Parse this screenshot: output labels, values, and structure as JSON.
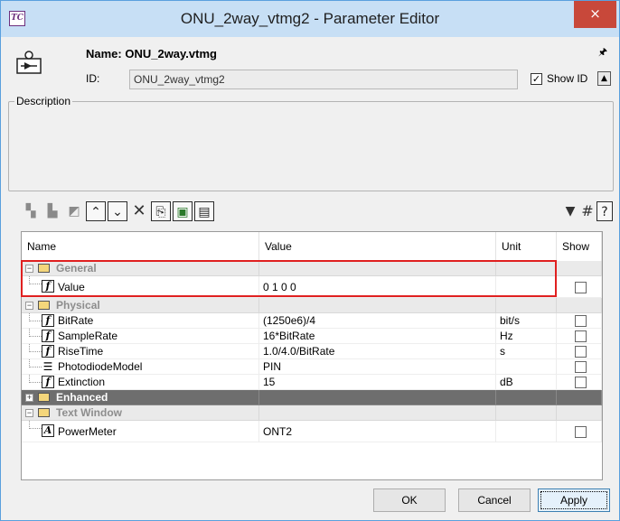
{
  "window": {
    "title": "ONU_2way_vtmg2 - Parameter Editor",
    "app_icon_text": "TC",
    "close_symbol": "×"
  },
  "header": {
    "name_label": "Name: ONU_2way.vtmg",
    "id_label": "ID:",
    "id_value": "ONU_2way_vtmg2",
    "show_id_label": "Show ID",
    "show_id_checked": true
  },
  "description": {
    "label": "Description",
    "text": ""
  },
  "table": {
    "columns": [
      "Name",
      "Value",
      "Unit",
      "Show"
    ],
    "groups": [
      {
        "label": "General",
        "expanded": true,
        "params": [
          {
            "type": "f",
            "name": "Value",
            "value": "0 1 0 0",
            "unit": "",
            "show": false
          }
        ]
      },
      {
        "label": "Physical",
        "expanded": true,
        "params": [
          {
            "type": "f",
            "name": "BitRate",
            "value": "(1250e6)/4",
            "unit": "bit/s",
            "show": false
          },
          {
            "type": "f",
            "name": "SampleRate",
            "value": "16*BitRate",
            "unit": "Hz",
            "show": false
          },
          {
            "type": "f",
            "name": "RiseTime",
            "value": "1.0/4.0/BitRate",
            "unit": "s",
            "show": false
          },
          {
            "type": "list",
            "name": "PhotodiodeModel",
            "value": "PIN",
            "unit": "",
            "show": false
          },
          {
            "type": "f",
            "name": "Extinction",
            "value": "15",
            "unit": "dB",
            "show": false
          }
        ]
      },
      {
        "label": "Enhanced",
        "expanded": false,
        "params": []
      },
      {
        "label": "Text Window",
        "expanded": true,
        "params": [
          {
            "type": "A",
            "name": "PowerMeter",
            "value": "ONT2",
            "unit": "",
            "show": false
          }
        ]
      }
    ]
  },
  "buttons": {
    "ok": "OK",
    "cancel": "Cancel",
    "apply": "Apply"
  },
  "colors": {
    "highlight": "#e02020",
    "titlebar": "#c7dff5",
    "close": "#c8483a"
  }
}
